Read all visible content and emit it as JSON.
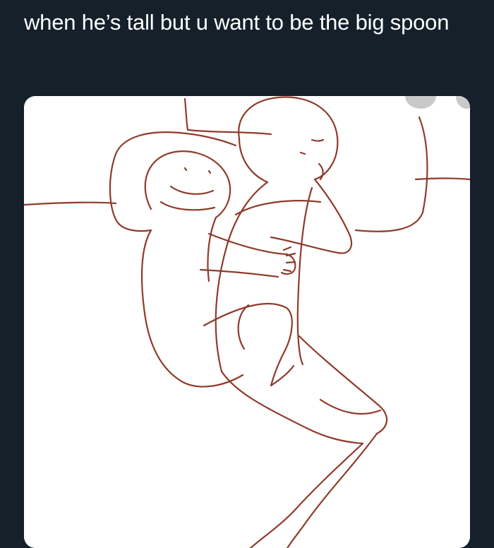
{
  "tweet": {
    "text": "when he’s tall but u want to be the big spoon"
  },
  "media": {
    "alt_description": "",
    "line_color": "#8f3b2b",
    "icon": "spooning-drawing"
  },
  "colors": {
    "background": "#15202b",
    "text": "#ffffff",
    "card": "#ffffff"
  }
}
